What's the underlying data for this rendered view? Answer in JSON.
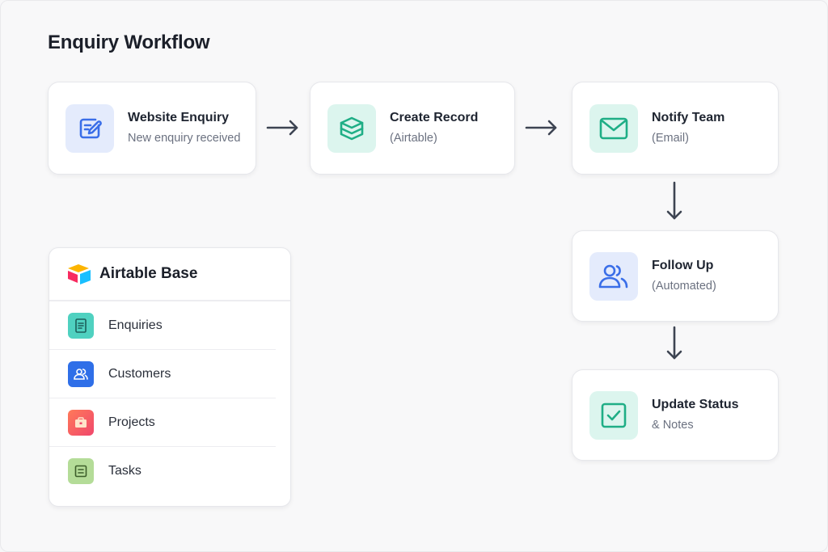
{
  "title": "Enquiry Workflow",
  "steps": [
    {
      "title": "Website Enquiry",
      "subtitle": "New enquiry received",
      "icon": "edit-form-icon",
      "color": "#3a6ee8"
    },
    {
      "title": "Create Record",
      "subtitle": "(Airtable)",
      "icon": "box-record-icon",
      "color": "#1fae86"
    },
    {
      "title": "Notify Team",
      "subtitle": "(Email)",
      "icon": "mail-icon",
      "color": "#1fae86"
    },
    {
      "title": "Follow Up",
      "subtitle": "(Automated)",
      "icon": "users-icon",
      "color": "#3a6ee8"
    },
    {
      "title": "Update Status",
      "subtitle": "& Notes",
      "icon": "checkbox-icon",
      "color": "#1fae86"
    }
  ],
  "base": {
    "title": "Airtable Base",
    "logo": "airtable-logo-icon",
    "tables": [
      {
        "label": "Enquiries",
        "icon": "document-icon",
        "color": "#3ec9b6"
      },
      {
        "label": "Customers",
        "icon": "users-icon",
        "color": "#2f6fe8"
      },
      {
        "label": "Projects",
        "icon": "briefcase-icon",
        "color": "#f25b66"
      },
      {
        "label": "Tasks",
        "icon": "list-icon",
        "color": "#a8d48b"
      }
    ]
  }
}
